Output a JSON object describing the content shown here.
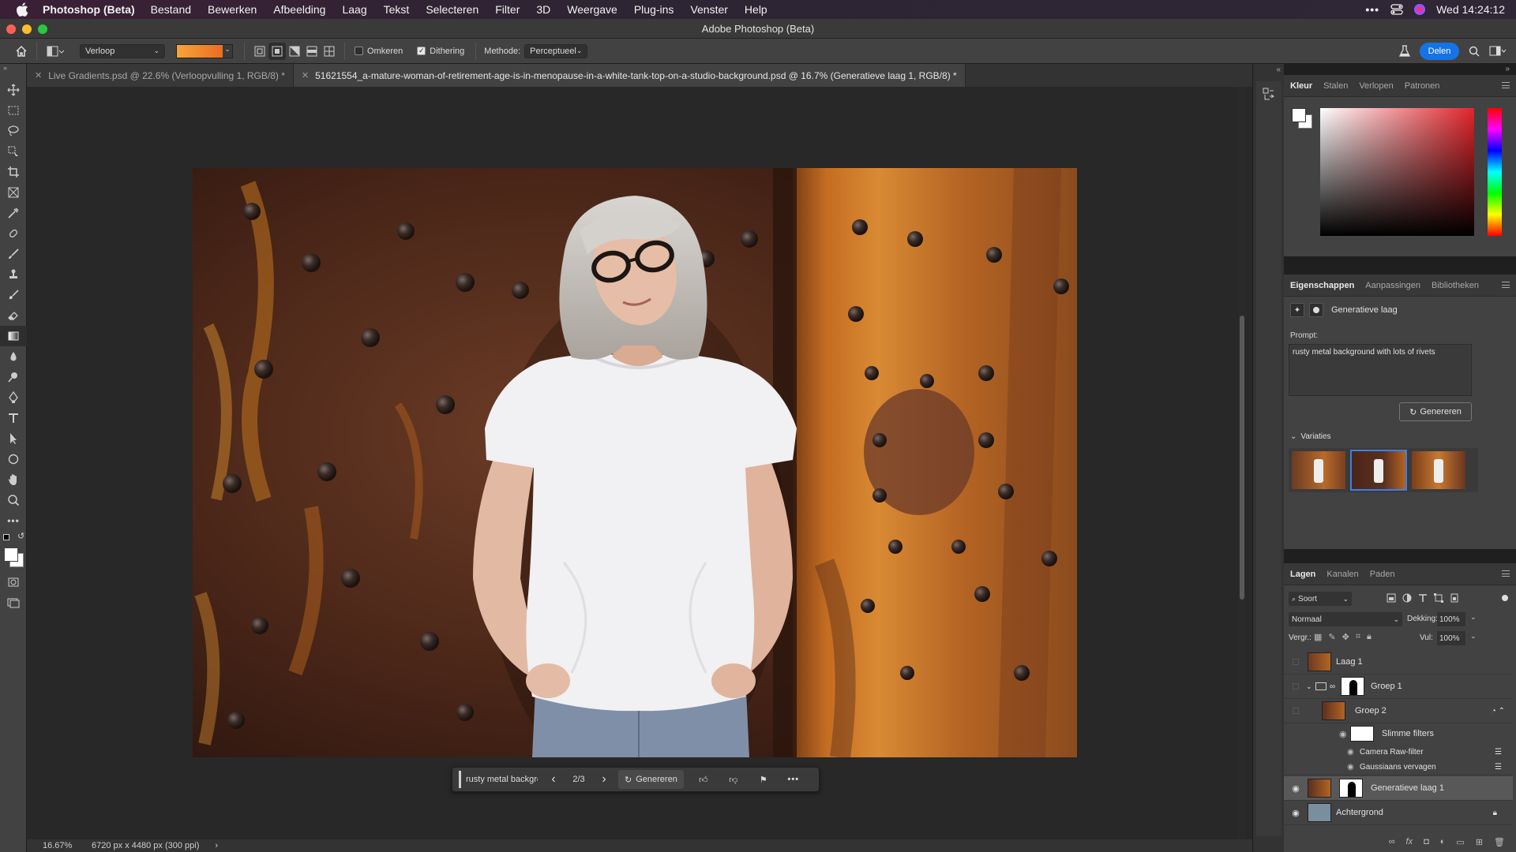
{
  "menubar": {
    "app_name": "Photoshop (Beta)",
    "items": [
      "Bestand",
      "Bewerken",
      "Afbeelding",
      "Laag",
      "Tekst",
      "Selecteren",
      "Filter",
      "3D",
      "Weergave",
      "Plug-ins",
      "Venster",
      "Help"
    ],
    "clock": "Wed  14:24:12"
  },
  "window": {
    "title": "Adobe Photoshop (Beta)"
  },
  "options": {
    "preset": "Verloop",
    "reverse_label": "Omkeren",
    "reverse_checked": false,
    "dither_label": "Dithering",
    "dither_checked": true,
    "method_label": "Methode:",
    "method_value": "Perceptueel",
    "share_label": "Delen",
    "gradient_colors": [
      "#f4a53a",
      "#e9611c"
    ]
  },
  "tabs": [
    {
      "label": "Live Gradients.psd @ 22.6% (Verloopvulling 1, RGB/8) *",
      "active": false
    },
    {
      "label": "51621554_a-mature-woman-of-retirement-age-is-in-menopause-in-a-white-tank-top-on-a-studio-background.psd @ 16.7% (Generatieve laag 1, RGB/8) *",
      "active": true
    }
  ],
  "context_bar": {
    "prompt": "rusty metal backgro",
    "counter": "2/3",
    "generate_label": "Genereren"
  },
  "status": {
    "zoom": "16.67%",
    "doc_size": "6720 px x 4480 px (300 ppi)"
  },
  "color_panel": {
    "tabs": [
      "Kleur",
      "Stalen",
      "Verlopen",
      "Patronen"
    ],
    "active": "Kleur",
    "hue_color": "#e0252b"
  },
  "properties": {
    "tabs": [
      "Eigenschappen",
      "Aanpassingen",
      "Bibliotheken"
    ],
    "active": "Eigenschappen",
    "layer_type": "Generatieve laag",
    "prompt_label": "Prompt:",
    "prompt_text": "rusty metal background with lots of rivets",
    "generate_label": "Genereren",
    "variations_label": "Variaties"
  },
  "layers_panel": {
    "tabs": [
      "Lagen",
      "Kanalen",
      "Paden"
    ],
    "active": "Lagen",
    "filter_label": "Soort",
    "blend_mode": "Normaal",
    "opacity_label": "Dekking:",
    "opacity": "100%",
    "lock_label": "Vergr.:",
    "fill_label": "Vul:",
    "fill": "100%",
    "layers": [
      {
        "name": "Laag 1",
        "visible": false
      },
      {
        "name": "Groep 1",
        "visible": false
      },
      {
        "name": "Groep 2",
        "visible": false
      },
      {
        "name": "Slimme filters",
        "visible": true
      },
      {
        "name": "Camera Raw-filter",
        "visible": true
      },
      {
        "name": "Gaussiaans vervagen",
        "visible": true
      },
      {
        "name": "Generatieve laag 1",
        "visible": true,
        "selected": true
      },
      {
        "name": "Achtergrond",
        "visible": true
      }
    ]
  }
}
